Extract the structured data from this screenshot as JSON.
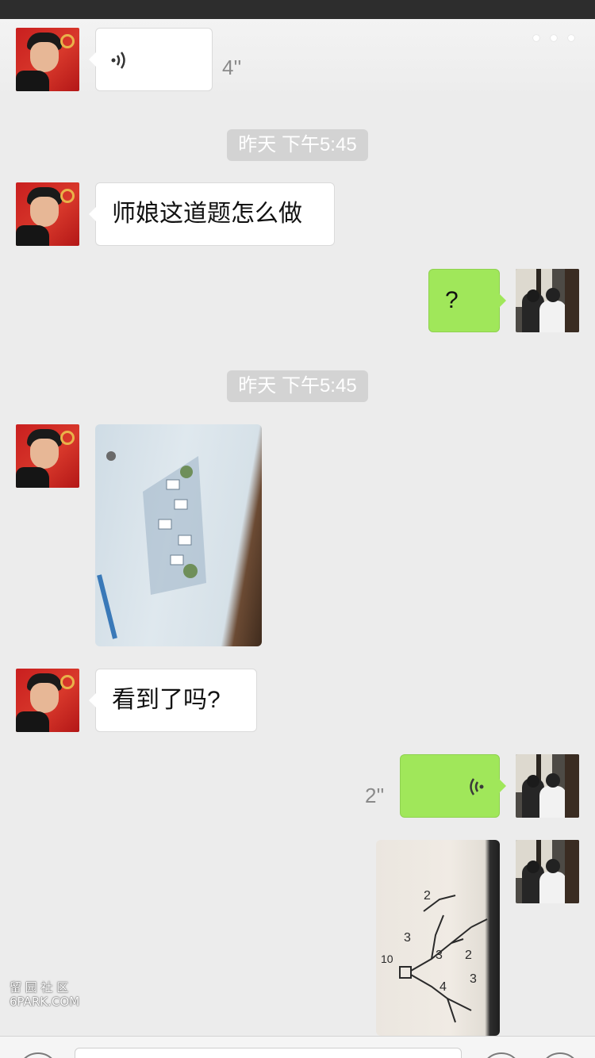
{
  "header": {
    "more_icon": "more-dots-icon"
  },
  "messages": {
    "voice_in": {
      "duration": "4''",
      "icon": "voice-wave-icon"
    },
    "time1": "昨天 下午5:45",
    "text_in_1": "师娘这道题怎么做",
    "text_out_1": "?",
    "time2": "昨天 下午5:45",
    "image_in": {
      "icon": "photo-icon"
    },
    "text_in_2": "看到了吗?",
    "voice_out": {
      "duration": "2''",
      "icon": "voice-wave-icon"
    },
    "image_out": {
      "icon": "photo-icon"
    }
  },
  "watermark": {
    "line1": "留 园 社 区",
    "line2": "6PARK.COM"
  },
  "colors": {
    "bg": "#ececec",
    "out_bubble": "#a0e75a",
    "in_bubble": "#ffffff",
    "time_pill": "#d3d3d3"
  }
}
